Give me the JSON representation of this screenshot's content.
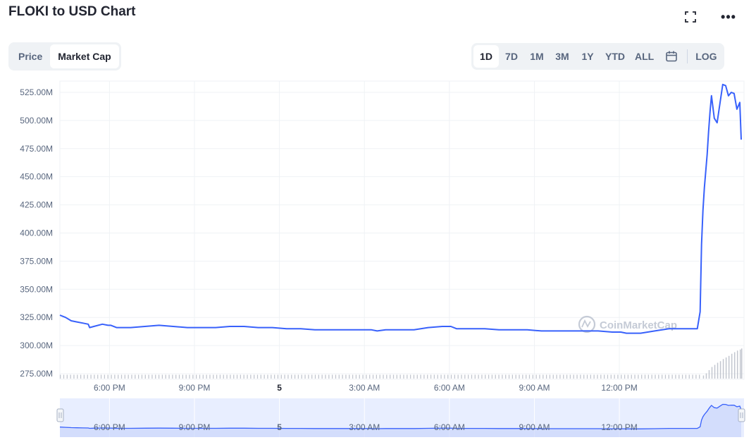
{
  "header": {
    "title": "FLOKI to USD Chart",
    "fullscreen_icon": "fullscreen-icon",
    "more_icon": "more-horizontal-icon",
    "more_label": "•••"
  },
  "toggle": {
    "items": [
      {
        "label": "Price",
        "active": false
      },
      {
        "label": "Market Cap",
        "active": true
      }
    ]
  },
  "ranges": {
    "items": [
      "1D",
      "7D",
      "1M",
      "3M",
      "1Y",
      "YTD",
      "ALL"
    ],
    "active": "1D",
    "calendar_icon": "calendar-icon",
    "log_label": "LOG"
  },
  "watermark": "CoinMarketCap",
  "colors": {
    "line": "#3861fb",
    "volume": "#c2c6cf",
    "navigator_fill": "#e8eeff",
    "grid": "#eff2f5"
  },
  "chart_data": {
    "type": "line",
    "title": "FLOKI to USD Chart",
    "xlabel": "",
    "ylabel": "",
    "ylim": [
      270,
      535
    ],
    "xlim": [
      0,
      24.15
    ],
    "grid": true,
    "y_ticks": [
      "275.00M",
      "300.00M",
      "325.00M",
      "350.00M",
      "375.00M",
      "400.00M",
      "425.00M",
      "450.00M",
      "475.00M",
      "500.00M",
      "525.00M"
    ],
    "y_tick_values": [
      275,
      300,
      325,
      350,
      375,
      400,
      425,
      450,
      475,
      500,
      525
    ],
    "x_ticks": [
      {
        "label": "6:00 PM",
        "x": 1.75,
        "bold": false
      },
      {
        "label": "9:00 PM",
        "x": 4.75,
        "bold": false
      },
      {
        "label": "5",
        "x": 7.75,
        "bold": true
      },
      {
        "label": "3:00 AM",
        "x": 10.75,
        "bold": false
      },
      {
        "label": "6:00 AM",
        "x": 13.75,
        "bold": false
      },
      {
        "label": "9:00 AM",
        "x": 16.75,
        "bold": false
      },
      {
        "label": "12:00 PM",
        "x": 19.75,
        "bold": false
      }
    ],
    "series": [
      {
        "name": "",
        "x": [
          0,
          0.2,
          0.4,
          0.6,
          0.8,
          1.0,
          1.05,
          1.2,
          1.5,
          1.7,
          1.8,
          2.0,
          2.5,
          3.0,
          3.5,
          4.0,
          4.5,
          5.0,
          5.5,
          6.0,
          6.5,
          7.0,
          7.5,
          8.0,
          8.5,
          9.0,
          9.5,
          10.0,
          10.5,
          11.0,
          11.2,
          11.5,
          12.0,
          12.5,
          13.0,
          13.5,
          13.8,
          14.0,
          14.5,
          15.0,
          15.5,
          16.0,
          16.5,
          17.0,
          17.5,
          18.0,
          18.5,
          19.0,
          19.5,
          19.8,
          20.0,
          20.5,
          21.0,
          21.5,
          22.0,
          22.5,
          22.6,
          22.65,
          22.7,
          22.75,
          22.8,
          22.85,
          22.9,
          22.95,
          23.0,
          23.1,
          23.2,
          23.3,
          23.4,
          23.5,
          23.6,
          23.7,
          23.8,
          23.9,
          24.0,
          24.05
        ],
        "values": [
          327,
          325,
          322,
          321,
          320,
          319,
          316,
          317,
          319,
          318,
          318,
          316,
          316,
          317,
          318,
          317,
          316,
          316,
          316,
          317,
          317,
          316,
          316,
          315,
          315,
          314,
          314,
          314,
          314,
          314,
          313,
          314,
          314,
          314,
          316,
          317,
          317,
          315,
          315,
          315,
          314,
          314,
          314,
          313,
          313,
          313,
          313,
          313,
          312,
          312,
          311,
          311,
          313,
          315,
          315,
          315,
          330,
          390,
          420,
          440,
          455,
          470,
          490,
          508,
          522,
          502,
          498,
          515,
          532,
          531,
          522,
          525,
          524,
          510,
          516,
          483
        ]
      }
    ],
    "volume": {
      "x": [
        22.7,
        22.8,
        22.9,
        23.0,
        23.1,
        23.2,
        23.3,
        23.4,
        23.5,
        23.6,
        23.7,
        23.8,
        23.9,
        24.0,
        24.05
      ],
      "values": [
        6,
        10,
        16,
        22,
        26,
        30,
        33,
        37,
        40,
        43,
        47,
        50,
        53,
        55,
        57
      ],
      "baseline": 6
    },
    "navigator": {
      "x_ticks": [
        "6:00 PM",
        "9:00 PM",
        "5",
        "3:00 AM",
        "6:00 AM",
        "9:00 AM",
        "12:00 PM"
      ]
    }
  }
}
